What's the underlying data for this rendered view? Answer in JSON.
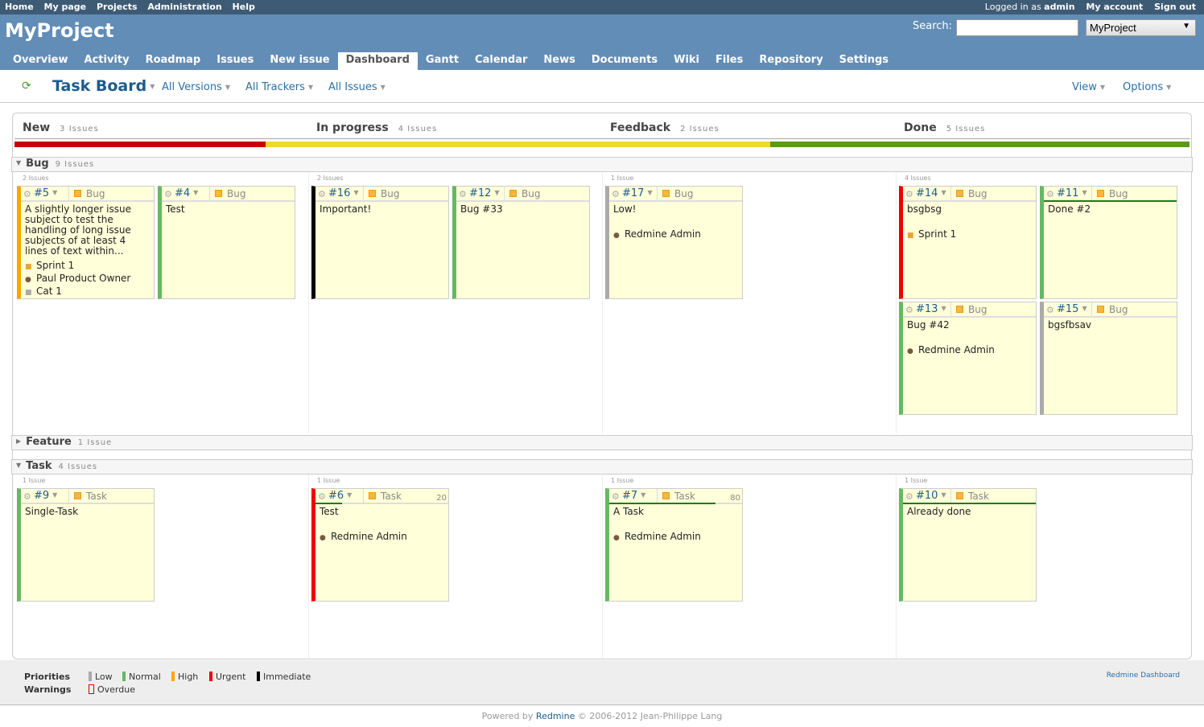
{
  "top_menu": {
    "links": [
      "Home",
      "My page",
      "Projects",
      "Administration",
      "Help"
    ],
    "logged_in_prefix": "Logged in as",
    "user": "admin",
    "my_account": "My account",
    "sign_out": "Sign out"
  },
  "header": {
    "project_title": "MyProject",
    "search_label": "Search:",
    "search_value": "",
    "project_select": "MyProject"
  },
  "main_menu": {
    "tabs": [
      "Overview",
      "Activity",
      "Roadmap",
      "Issues",
      "New issue",
      "Dashboard",
      "Gantt",
      "Calendar",
      "News",
      "Documents",
      "Wiki",
      "Files",
      "Repository",
      "Settings"
    ],
    "selected": "Dashboard"
  },
  "toolbar": {
    "title": "Task Board",
    "filters": [
      "All Versions",
      "All Trackers",
      "All Issues"
    ],
    "view": "View",
    "options": "Options"
  },
  "statuses": [
    {
      "name": "New",
      "count": "3 Issues",
      "color": "#cc0000",
      "share": 0.214
    },
    {
      "name": "In progress",
      "count": "4 Issues",
      "color": "#f0d82c",
      "share": 0.286
    },
    {
      "name": "Feedback",
      "count": "2 Issues",
      "color": "#f0d82c",
      "share": 0.143
    },
    {
      "name": "Done",
      "count": "5 Issues",
      "color": "#5a9a18",
      "share": 0.357
    }
  ],
  "swimlanes": [
    {
      "name": "Bug",
      "count": "9 Issues",
      "expanded": true,
      "column_counts": [
        "2 Issues",
        "2 Issues",
        "1 Issue",
        "4 Issues"
      ]
    },
    {
      "name": "Feature",
      "count": "1 Issue",
      "expanded": false
    },
    {
      "name": "Task",
      "count": "4 Issues",
      "expanded": true,
      "column_counts": [
        "1 Issue",
        "1 Issue",
        "1 Issue",
        "1 Issue"
      ]
    }
  ],
  "cards": [
    {
      "id": "#5",
      "tracker": "Bug",
      "priority": "High",
      "subject": "A slightly longer issue subject to test the handling of long issue subjects of at least 4 lines of text within...",
      "version": "Sprint 1",
      "assignee": "Paul Product Owner",
      "category": "Cat 1"
    },
    {
      "id": "#4",
      "tracker": "Bug",
      "priority": "Normal",
      "subject": "Test"
    },
    {
      "id": "#16",
      "tracker": "Bug",
      "priority": "Immediate",
      "subject": "Important!"
    },
    {
      "id": "#12",
      "tracker": "Bug",
      "priority": "Normal",
      "subject": "Bug #33"
    },
    {
      "id": "#17",
      "tracker": "Bug",
      "priority": "Low",
      "subject": "Low!",
      "assignee": "Redmine Admin"
    },
    {
      "id": "#14",
      "tracker": "Bug",
      "priority": "Urgent",
      "subject": "bsgbsg",
      "version": "Sprint 1"
    },
    {
      "id": "#11",
      "tracker": "Bug",
      "priority": "Normal",
      "subject": "Done #2",
      "done_ratio": 100
    },
    {
      "id": "#13",
      "tracker": "Bug",
      "priority": "Normal",
      "subject": "Bug #42",
      "assignee": "Redmine Admin"
    },
    {
      "id": "#15",
      "tracker": "Bug",
      "priority": "Low",
      "subject": "bgsfbsav"
    },
    {
      "id": "#9",
      "tracker": "Task",
      "priority": "Normal",
      "subject": "Single-Task"
    },
    {
      "id": "#6",
      "tracker": "Task",
      "priority": "Urgent",
      "subject": "Test",
      "assignee": "Redmine Admin",
      "done_ratio": 20,
      "done_label": "20"
    },
    {
      "id": "#7",
      "tracker": "Task",
      "priority": "Normal",
      "subject": "A Task",
      "assignee": "Redmine Admin",
      "done_ratio": 80,
      "done_label": "80"
    },
    {
      "id": "#10",
      "tracker": "Task",
      "priority": "Normal",
      "subject": "Already done",
      "done_ratio": 100
    }
  ],
  "priority_colors": {
    "Low": "#aaaaaa",
    "Normal": "#67b862",
    "High": "#ffa500",
    "Urgent": "#ee0000",
    "Immediate": "#000000"
  },
  "legend": {
    "priorities_label": "Priorities",
    "priorities": [
      "Low",
      "Normal",
      "High",
      "Urgent",
      "Immediate"
    ],
    "warnings_label": "Warnings",
    "warnings": [
      "Overdue"
    ],
    "dashboard_link": "Redmine Dashboard"
  },
  "footer": {
    "prefix": "Powered by",
    "link": "Redmine",
    "suffix": "© 2006-2012 Jean-Philippe Lang"
  }
}
